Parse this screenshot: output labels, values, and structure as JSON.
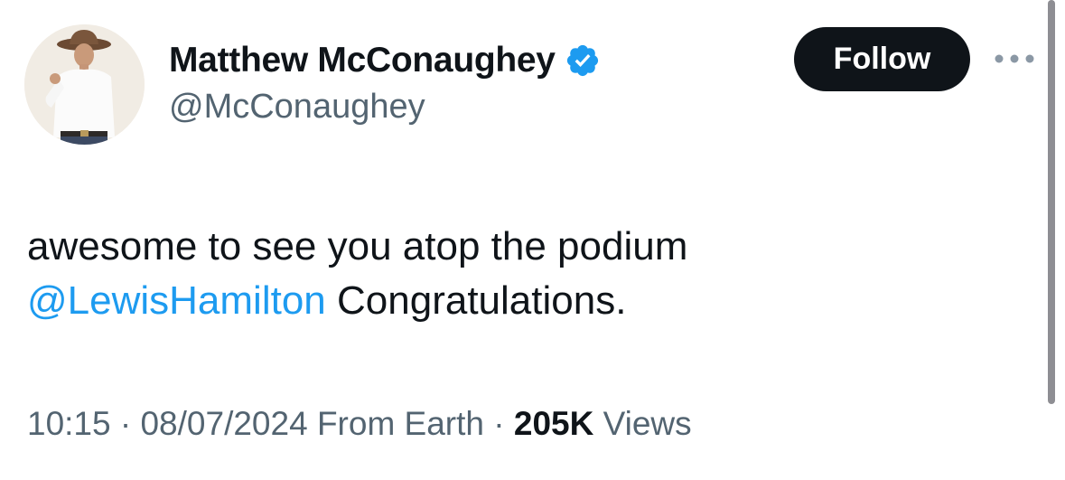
{
  "author": {
    "display_name": "Matthew McConaughey",
    "handle": "@McConaughey",
    "verified": true
  },
  "actions": {
    "follow_label": "Follow",
    "more_icon": "more-horizontal-icon"
  },
  "tweet": {
    "text_line1": "awesome to see you atop the podium",
    "mention": "@LewisHamilton",
    "text_after_mention": " Congratulations."
  },
  "meta": {
    "time": "10:15",
    "separator1": " · ",
    "date": "08/07/2024",
    "source": " From Earth",
    "separator2": " · ",
    "views_count": "205K",
    "views_label": " Views"
  },
  "colors": {
    "text": "#0f1419",
    "secondary": "#536471",
    "accent": "#1d9bf0",
    "follow_bg": "#0f1419"
  }
}
